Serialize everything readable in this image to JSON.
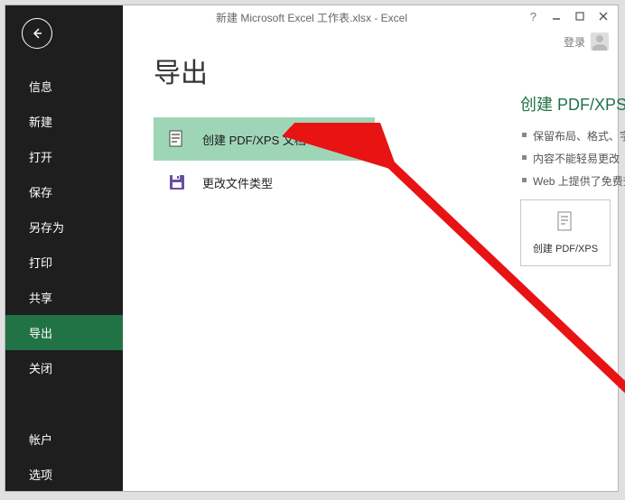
{
  "window": {
    "title": "新建 Microsoft Excel 工作表.xlsx - Excel",
    "login": "登录"
  },
  "sidebar": {
    "items": [
      {
        "label": "信息"
      },
      {
        "label": "新建"
      },
      {
        "label": "打开"
      },
      {
        "label": "保存"
      },
      {
        "label": "另存为"
      },
      {
        "label": "打印"
      },
      {
        "label": "共享"
      },
      {
        "label": "导出",
        "selected": true
      },
      {
        "label": "关闭"
      },
      {
        "label": "帐户",
        "break": true
      },
      {
        "label": "选项"
      }
    ]
  },
  "page": {
    "title": "导出",
    "options": [
      {
        "label": "创建 PDF/XPS 文档",
        "selected": true,
        "icon": "pdf"
      },
      {
        "label": "更改文件类型",
        "selected": false,
        "icon": "save"
      }
    ]
  },
  "right": {
    "heading": "创建 PDF/XPS 文档",
    "bullets": [
      "保留布局、格式、字体和图像",
      "内容不能轻易更改",
      "Web 上提供了免费查看器"
    ],
    "button_label": "创建 PDF/XPS"
  }
}
